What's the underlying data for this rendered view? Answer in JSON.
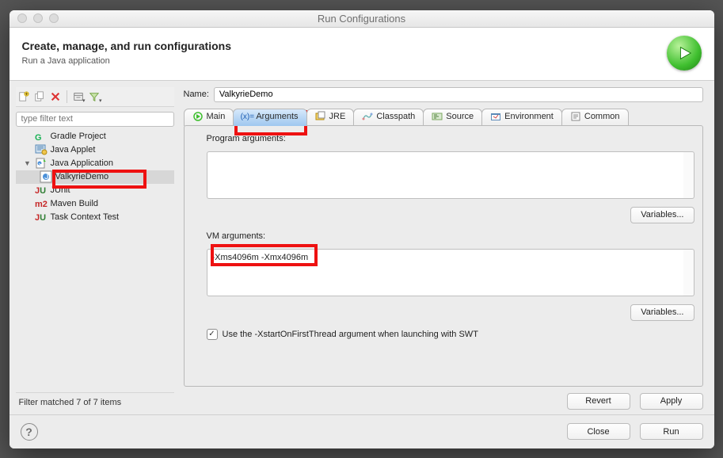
{
  "title": "Run Configurations",
  "header": {
    "title": "Create, manage, and run configurations",
    "subtitle": "Run a Java application"
  },
  "filter_placeholder": "type filter text",
  "tree": {
    "gradle": "Gradle Project",
    "applet": "Java Applet",
    "javaapp": "Java Application",
    "valkyrie": "ValkyrieDemo",
    "junit": "JUnit",
    "maven": "Maven Build",
    "taskctx": "Task Context Test"
  },
  "status": "Filter matched 7 of 7 items",
  "name_label": "Name:",
  "name_value": "ValkyrieDemo",
  "tabs": {
    "main": "Main",
    "arguments": "Arguments",
    "jre": "JRE",
    "classpath": "Classpath",
    "source": "Source",
    "environment": "Environment",
    "common": "Common"
  },
  "panel": {
    "prog_label": "Program arguments:",
    "prog_value": "",
    "vm_label": "VM arguments:",
    "vm_value": "-Xms4096m -Xmx4096m",
    "variables_btn": "Variables...",
    "swt_checkbox": "Use the -XstartOnFirstThread argument when launching with SWT"
  },
  "buttons": {
    "revert": "Revert",
    "apply": "Apply",
    "close": "Close",
    "run": "Run"
  }
}
